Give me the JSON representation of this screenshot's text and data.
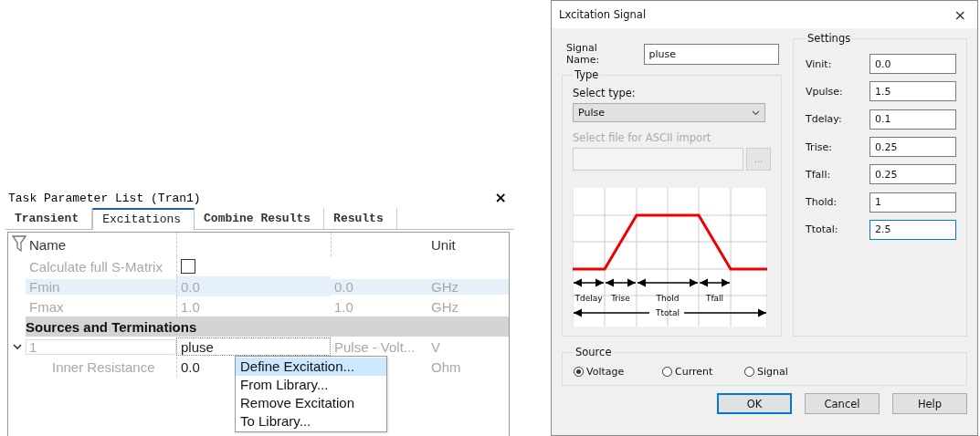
{
  "task_panel": {
    "title": "Task Parameter List (Tran1)",
    "close": "×",
    "tabs": [
      {
        "label": "Transient",
        "selected": false
      },
      {
        "label": "Excitations",
        "selected": true
      },
      {
        "label": "Combine Results",
        "selected": false
      },
      {
        "label": "Results",
        "selected": false
      }
    ],
    "header": {
      "name": "Name",
      "unit": "Unit"
    },
    "rows": [
      {
        "kind": "checkbox",
        "name": "Calculate full S-Matrix",
        "checked": false
      },
      {
        "kind": "value",
        "name": "Fmin",
        "value": "0.0",
        "column_3": "0.0",
        "unit": "GHz",
        "selected": true
      },
      {
        "kind": "value",
        "name": "Fmax",
        "value": "1.0",
        "column_3": "1.0",
        "unit": "GHz",
        "selected": false
      },
      {
        "kind": "section",
        "name": "Sources and Terminations"
      },
      {
        "kind": "port",
        "name": "1",
        "value": "pluse",
        "column_3": "Pulse - Volt...",
        "unit": "V",
        "expanded": true,
        "children": [
          {
            "kind": "child",
            "name": "Inner Resistance",
            "value": "0.0",
            "unit": "Ohm"
          }
        ]
      }
    ]
  },
  "context_menu": {
    "items": [
      {
        "label": "Define Excitation...",
        "selected": true
      },
      {
        "label": "From Library...",
        "selected": false
      },
      {
        "label": "Remove Excitation",
        "selected": false
      },
      {
        "label": "To Library...",
        "selected": false
      }
    ]
  },
  "dialog": {
    "title": "Lxcitation Signal",
    "close": "×",
    "signal_name": {
      "label": "Signal Name:",
      "value": "pluse"
    },
    "type": {
      "title": "Type",
      "select_label": "Select type:",
      "select_value": "Pulse",
      "file_label": "Select file for ASCII import",
      "file_disabled": true,
      "browse": "...",
      "diagram_labels": [
        "Tdelay",
        "Trise",
        "Thold",
        "Tfall"
      ],
      "diagram_total": "Ttotal"
    },
    "settings": {
      "title": "Settings",
      "fields": [
        {
          "label": "Vinit:",
          "value": "0.0",
          "focused": false
        },
        {
          "label": "Vpulse:",
          "value": "1.5",
          "focused": false
        },
        {
          "label": "Tdelay:",
          "value": "0.1",
          "focused": false
        },
        {
          "label": "Trise:",
          "value": "0.25",
          "focused": false
        },
        {
          "label": "Tfall:",
          "value": "0.25",
          "focused": false
        },
        {
          "label": "Thold:",
          "value": "1",
          "focused": false
        },
        {
          "label": "Ttotal:",
          "value": "2.5",
          "focused": true
        }
      ]
    },
    "source": {
      "title": "Source",
      "options": [
        {
          "label": "Voltage",
          "selected": true
        },
        {
          "label": "Current",
          "selected": false
        },
        {
          "label": "Signal",
          "selected": false
        }
      ]
    },
    "buttons": [
      {
        "label": "OK",
        "default": true
      },
      {
        "label": "Cancel",
        "default": false
      },
      {
        "label": "Help",
        "default": false
      }
    ]
  }
}
